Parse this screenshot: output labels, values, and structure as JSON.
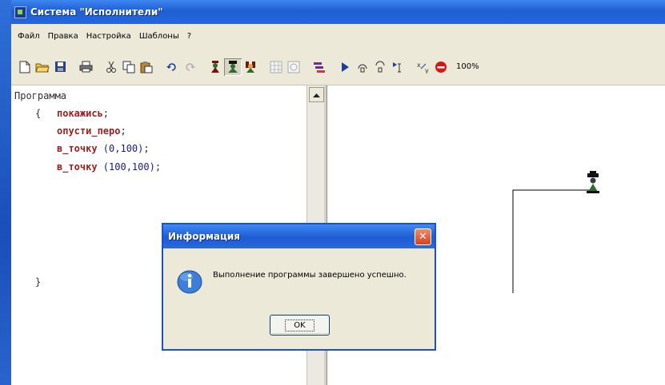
{
  "window": {
    "title": "Система \"Исполнители\""
  },
  "menu": {
    "items": [
      "Файл",
      "Правка",
      "Настройка",
      "Шаблоны",
      "?"
    ]
  },
  "toolbar": {
    "icons": [
      "new-file-icon",
      "open-folder-icon",
      "save-icon",
      "print-icon",
      "cut-icon",
      "copy-icon",
      "paste-icon",
      "undo-icon",
      "redo-icon",
      "performer-icon",
      "performer-selected-icon",
      "performer-alt-icon",
      "grid-icon",
      "refresh-icon",
      "step-list-icon",
      "run-icon",
      "step-into-icon",
      "step-over-icon",
      "run-to-cursor-icon",
      "trace-icon",
      "stop-icon"
    ],
    "zoom": "100%"
  },
  "editor": {
    "program_label": "Программа",
    "open_brace": "{",
    "close_brace": "}",
    "lines": [
      {
        "keyword": "покажись",
        "args": ";"
      },
      {
        "keyword": "опусти_перо",
        "args": ";"
      },
      {
        "keyword": "в_точку",
        "args": " (0,100);"
      },
      {
        "keyword": "в_точку",
        "args": " (100,100);"
      }
    ]
  },
  "dialog": {
    "title": "Информация",
    "message": "Выполнение программы завершено успешно.",
    "ok_label": "OK"
  },
  "colors": {
    "keyword": "#9c1e1e",
    "args": "#1a1a8a",
    "titlebar": "#2567de"
  }
}
